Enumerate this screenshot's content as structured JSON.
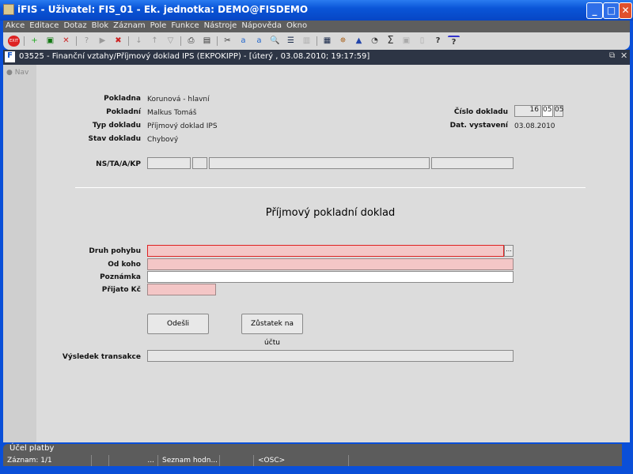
{
  "window": {
    "title": "iFIS - Uživatel: FIS_01 - Ek. jednotka: DEMO@FISDEMO"
  },
  "menu": [
    "Akce",
    "Editace",
    "Dotaz",
    "Blok",
    "Záznam",
    "Pole",
    "Funkce",
    "Nástroje",
    "Nápověda",
    "Okno"
  ],
  "form": {
    "title": "03525 - Finanční vztahy/Příjmový doklad IPS (EKPOKIPP) - [úterý  , 03.08.2010; 19:17:59]",
    "nav": "Nav"
  },
  "header": {
    "pokladna_label": "Pokladna",
    "pokladna": "Korunová - hlavní",
    "pokladni_label": "Pokladní",
    "pokladni": "Malkus Tomáš",
    "typ_label": "Typ dokladu",
    "typ": "Příjmový doklad IPS",
    "stav_label": "Stav dokladu",
    "stav": "Chybový",
    "cislo_label": "Číslo dokladu",
    "cislo_1": "16",
    "cislo_2": "05",
    "cislo_3": "05",
    "dat_label": "Dat. vystavení",
    "dat": "03.08.2010",
    "ns_label": "NS/TA/A/KP"
  },
  "main": {
    "heading": "Příjmový pokladní doklad",
    "druh_label": "Druh pohybu",
    "odkoho_label": "Od koho",
    "poznamka_label": "Poznámka",
    "prijato_label": "Přijato Kč",
    "lov_button": "...",
    "send_button": "Odešli",
    "balance_button": "Zůstatek na účtu",
    "result_label": "Výsledek transakce"
  },
  "status": {
    "hint": "Účel platby",
    "record": "Záznam: 1/1",
    "dots": "...",
    "list": "Seznam hodn...",
    "mode": "<OSC>"
  }
}
